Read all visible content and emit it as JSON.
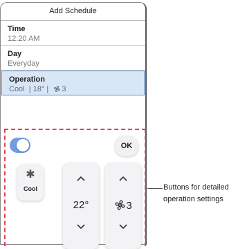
{
  "dialog": {
    "title": "Add Schedule",
    "rows": [
      {
        "label": "Time",
        "value": "12:20 AM"
      },
      {
        "label": "Day",
        "value": "Everyday"
      },
      {
        "label": "Operation",
        "value_mode": "Cool",
        "value_temp": "18°",
        "value_fan": "3",
        "selected": true
      }
    ]
  },
  "controls": {
    "toggle_on": true,
    "ok_label": "OK",
    "mode_label": "Cool",
    "mode_icon": "snowflake-icon",
    "temperature": "22°",
    "fan_speed": "3",
    "fan_icon": "fan-icon"
  },
  "annotation": {
    "line1": "Buttons for detailed",
    "line2": "operation settings"
  },
  "colors": {
    "selection_bg": "#d9e6f6",
    "selection_border": "#5a8fcf",
    "toggle": "#6f9ee0",
    "dash": "#e0434f"
  }
}
